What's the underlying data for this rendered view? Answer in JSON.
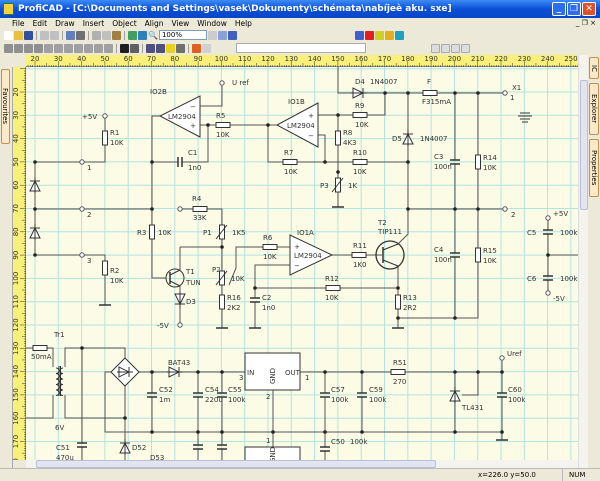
{
  "window": {
    "title": "ProfiCAD - [C:\\Documents and Settings\\vasek\\Dokumenty\\schémata\\nabíjeè aku. sxe]"
  },
  "menu": [
    "File",
    "Edit",
    "Draw",
    "Insert",
    "Object",
    "Align",
    "View",
    "Window",
    "Help"
  ],
  "toolbar": {
    "zoom": "100%"
  },
  "side_tabs": {
    "left": [
      "Favourites"
    ],
    "right": [
      "IC",
      "Explorer",
      "Properties"
    ]
  },
  "rulers": {
    "top": [
      "20",
      "30",
      "40",
      "50",
      "60",
      "70",
      "80",
      "90",
      "100",
      "110",
      "120",
      "130",
      "140",
      "150",
      "160",
      "170",
      "180",
      "190",
      "200",
      "210",
      "220",
      "230",
      "240",
      "250"
    ],
    "left": [
      "20",
      "30",
      "40",
      "50",
      "60",
      "70",
      "80",
      "90",
      "100",
      "110",
      "120",
      "130",
      "140",
      "150",
      "160",
      "170",
      "180"
    ]
  },
  "status": {
    "coords": "x=226.0  y=50.0",
    "num": "NUM"
  },
  "colors": {
    "grid": "#b2e4e0",
    "paper": "#fbfbe6",
    "wire": "#555555",
    "ruler": "#f8f07a",
    "titlebar": "#0a4fd6"
  },
  "schematic": {
    "uref_top": "U ref",
    "IO2B": {
      "ref": "IO2B",
      "type": "LM2904"
    },
    "IO1B": {
      "ref": "IO1B",
      "type": "LM2904"
    },
    "IO1A": {
      "ref": "IO1A",
      "type": "LM2904"
    },
    "R1": {
      "ref": "R1",
      "value": "10K"
    },
    "R2": {
      "ref": "R2",
      "value": "10K"
    },
    "R3": {
      "ref": "R3",
      "value": "10K"
    },
    "R4": {
      "ref": "R4",
      "value": "33K"
    },
    "R5": {
      "ref": "R5",
      "value": "10K"
    },
    "R6": {
      "ref": "R6",
      "value": "10K"
    },
    "R7": {
      "ref": "R7",
      "value": "10K"
    },
    "R8": {
      "ref": "R8",
      "value": "4K3"
    },
    "R9": {
      "ref": "R9",
      "value": "10K"
    },
    "R10": {
      "ref": "R10",
      "value": "10K"
    },
    "R11": {
      "ref": "R11",
      "value": "1K0"
    },
    "R12": {
      "ref": "R12",
      "value": "10K"
    },
    "R13": {
      "ref": "R13",
      "value": "2R2"
    },
    "R14": {
      "ref": "R14",
      "value": "10K"
    },
    "R15": {
      "ref": "R15",
      "value": "10K"
    },
    "R16": {
      "ref": "R16",
      "value": "2K2"
    },
    "R51": {
      "ref": "R51",
      "value": "270"
    },
    "P1": {
      "ref": "P1",
      "value": "1K5"
    },
    "P2": {
      "ref": "P2",
      "value": "10K"
    },
    "P3": {
      "ref": "P3",
      "value": "1K"
    },
    "C1": {
      "ref": "C1",
      "value": "1n0"
    },
    "C2": {
      "ref": "C2",
      "value": "1n0"
    },
    "C3": {
      "ref": "C3",
      "value": "100n"
    },
    "C4": {
      "ref": "C4",
      "value": "100n"
    },
    "C5": {
      "ref": "C5",
      "value": "100k"
    },
    "C6": {
      "ref": "C6",
      "value": "100k"
    },
    "C50": {
      "ref": "C50",
      "value": "100k"
    },
    "C51": {
      "ref": "C51",
      "value": "470u"
    },
    "C52": {
      "ref": "C52",
      "value": "1m"
    },
    "C54": {
      "ref": "C54",
      "value": "220u"
    },
    "C55": {
      "ref": "C55",
      "value": "100k"
    },
    "C57": {
      "ref": "C57",
      "value": "100k"
    },
    "C59": {
      "ref": "C59",
      "value": "100k"
    },
    "C60": {
      "ref": "C60",
      "value": "100k"
    },
    "D3": {
      "ref": "D3"
    },
    "D4": {
      "ref": "D4",
      "value": "1N4007"
    },
    "D5": {
      "ref": "D5",
      "value": "1N4007"
    },
    "D52": {
      "ref": "D52"
    },
    "D53": {
      "ref": "D53"
    },
    "BAT43": {
      "ref": "BAT43"
    },
    "T1": {
      "ref": "T1",
      "value": "TUN"
    },
    "T2": {
      "ref": "T2",
      "value": "TIP111"
    },
    "F": {
      "ref": "F",
      "value": "F315mA"
    },
    "X1": {
      "ref": "X1",
      "pin": "1"
    },
    "Tr1": {
      "ref": "Tr1",
      "fuse": "50mA",
      "secondary": "6V"
    },
    "TL431": {
      "ref": "TL431"
    },
    "reg": {
      "in": "IN",
      "out": "OUT",
      "gnd": "GND",
      "pin_in": "3",
      "pin_gnd": "2",
      "pin_out": "1",
      "pin_low": "1"
    },
    "terminals": {
      "plus5_left": "+5V",
      "t1": "1",
      "t2": "2",
      "t3": "3",
      "minus5": "-5V",
      "out2": "2",
      "plus5_right": "+5V",
      "minus5_right": "-5V",
      "uref": "Uref"
    }
  }
}
